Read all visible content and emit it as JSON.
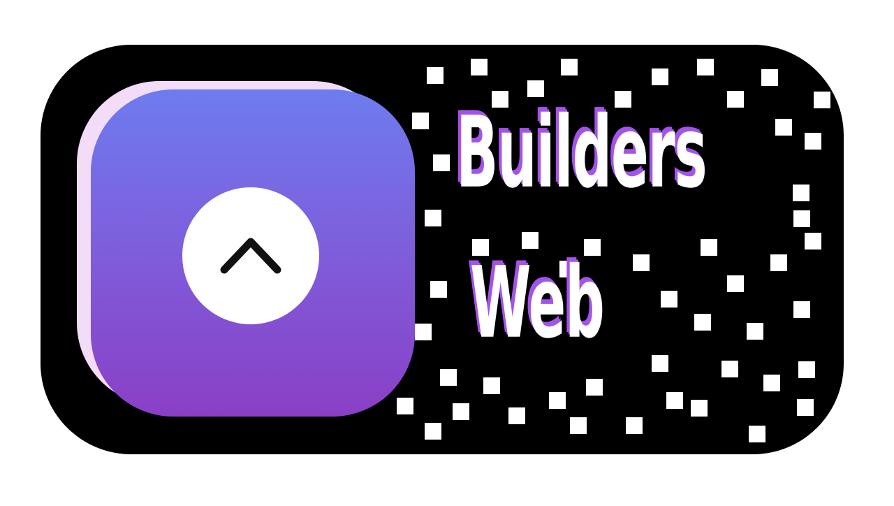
{
  "logo": {
    "line1": "Builders",
    "line2": "Web",
    "icon": "chevron-up-icon",
    "colors": {
      "badge_background": "#000000",
      "tile_gradient_top": "#6d7cee",
      "tile_gradient_bottom": "#8a3fc6",
      "tile_shadow": "#f2dcf7",
      "text": "#ffffff",
      "text_outline": "#a453ea",
      "pixels": "#ffffff"
    }
  }
}
